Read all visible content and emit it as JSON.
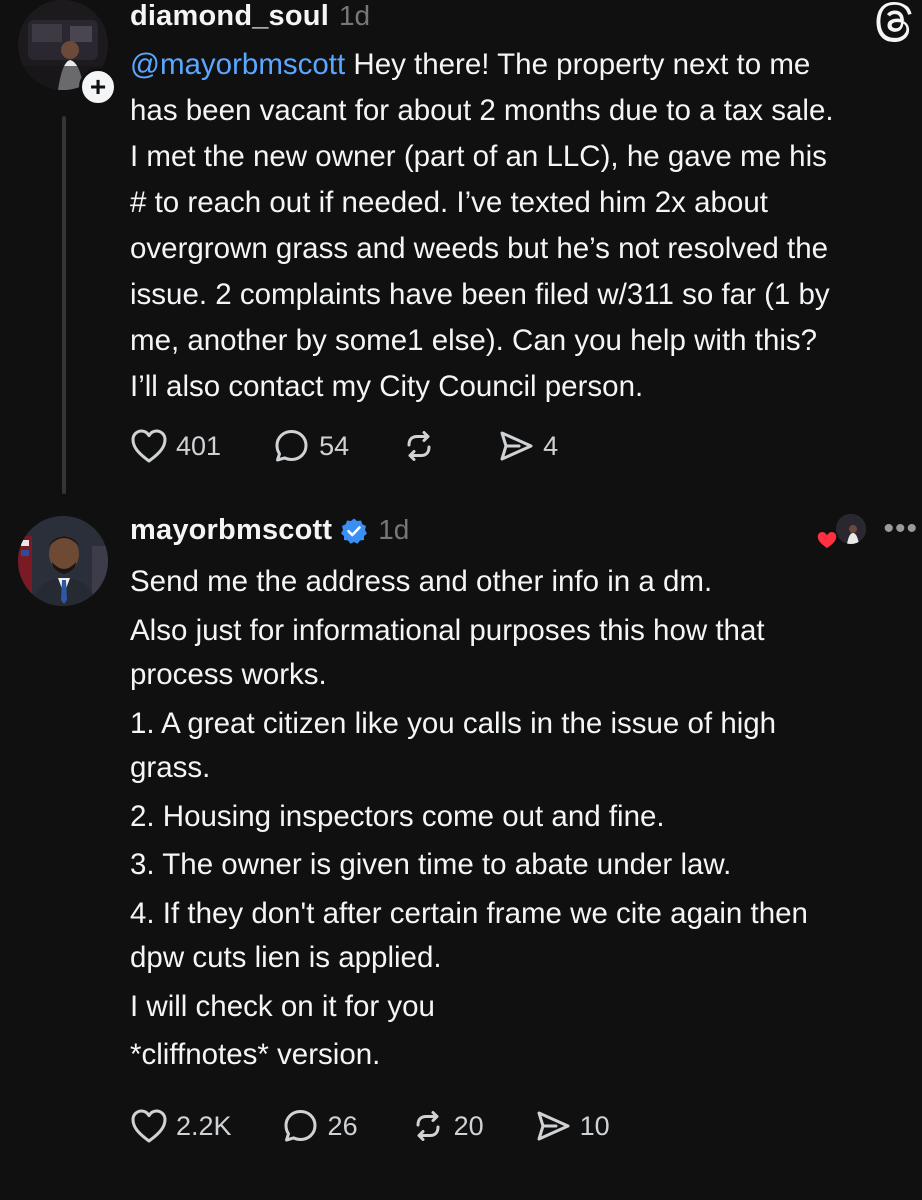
{
  "posts": [
    {
      "username": "diamond_soul",
      "time": "1d",
      "mention": "@mayorbmscott",
      "lines": [
        " Hey there! The property next to me",
        "has been vacant for about 2 months due to a tax sale.",
        "I met the new owner (part of an LLC), he gave me his",
        "# to reach out if needed. I’ve texted him 2x about",
        "overgrown grass and weeds but he’s not resolved the",
        "issue. 2 complaints have been filed w/311 so far (1 by",
        "me, another by some1 else). Can you help with this?",
        "I’ll also contact my City Council person."
      ],
      "likes": "401",
      "replies": "54",
      "reposts": "",
      "shares": "4"
    },
    {
      "username": "mayorbmscott",
      "time": "1d",
      "verified": true,
      "lines": [
        "Send me the address and other info in a dm.",
        "Also just for informational purposes this how that",
        "process works.",
        "1. A great citizen like you calls in the issue of high",
        "grass.",
        "2. Housing inspectors come out and fine.",
        "3. The owner is given time to abate under law.",
        "4. If they don't after certain frame we cite again then",
        "dpw cuts lien is applied.",
        "I will check on it for you",
        "*cliffnotes* version."
      ],
      "likes": "2.2K",
      "replies": "26",
      "reposts": "20",
      "shares": "10"
    }
  ],
  "icons": {
    "like": "heart-icon",
    "reply": "speech-bubble-icon",
    "repost": "repost-icon",
    "share": "send-icon",
    "app": "threads-logo-icon",
    "more": "more-dots-icon"
  },
  "colors": {
    "background": "#101010",
    "text": "#f3f5f7",
    "mention": "#5aa7ff",
    "verified": "#3a8ff5",
    "secondary": "#777777"
  }
}
